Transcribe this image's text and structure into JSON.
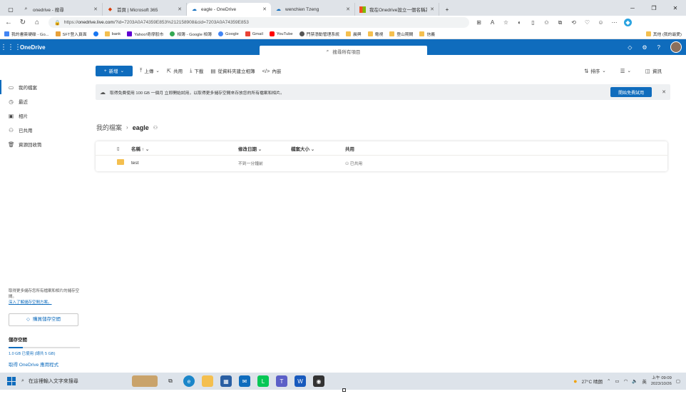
{
  "browser": {
    "tabs": [
      {
        "title": "onedrive - 搜尋",
        "icon": "search-icon",
        "active": false
      },
      {
        "title": "首頁 | Microsoft 365",
        "icon": "m365-icon",
        "active": false
      },
      {
        "title": "eagle - OneDrive",
        "icon": "onedrive-icon",
        "active": true
      },
      {
        "title": "wenchien Tzeng",
        "icon": "onedrive-icon",
        "active": false
      },
      {
        "title": "我在Onedrive設立一個名稱為ea",
        "icon": "microsoft-icon",
        "active": false
      }
    ],
    "new_tab": "+",
    "url_prefix": "https://",
    "url_host": "onedrive.live.com",
    "url_rest": "/?id=7203A0A74359E853%212158908&cid=7203A0A74359E853",
    "bookmarks": [
      {
        "label": "我的書簽硬碟 - Go...",
        "color": "#4285f4"
      },
      {
        "label": "SFT登入頁面",
        "color": "#e8a13a"
      },
      {
        "label": "",
        "color": "#1877f2"
      },
      {
        "label": "bank",
        "color": "#f4bf4f"
      },
      {
        "label": "Yahoo!奇摩股市",
        "color": "#6001d2"
      },
      {
        "label": "相簿 - Google 相簿",
        "color": "#34a853"
      },
      {
        "label": "Google",
        "color": "#4285f4"
      },
      {
        "label": "Gmail",
        "color": "#ea4335"
      },
      {
        "label": "YouTube",
        "color": "#ff0000"
      },
      {
        "label": "門禁憑動管理系統",
        "color": "#555555"
      },
      {
        "label": "晨興",
        "color": "#f4bf4f"
      },
      {
        "label": "電視",
        "color": "#f4bf4f"
      },
      {
        "label": "登山期間",
        "color": "#f4bf4f"
      },
      {
        "label": "信義",
        "color": "#f4bf4f"
      }
    ],
    "bookmarks_other": "其他 (我的最愛)"
  },
  "onedrive": {
    "brand": "OneDrive",
    "search_placeholder": "搜尋所有項目",
    "nav": [
      {
        "label": "我的檔案",
        "icon": "folder-icon",
        "selected": true
      },
      {
        "label": "最近",
        "icon": "clock-icon",
        "selected": false
      },
      {
        "label": "相片",
        "icon": "photo-icon",
        "selected": false
      },
      {
        "label": "已共用",
        "icon": "people-icon",
        "selected": false
      },
      {
        "label": "資源回收筒",
        "icon": "trash-icon",
        "selected": false
      }
    ],
    "upsell_text": "取得更多儲存您所有檔案和相片的儲存空間。",
    "upsell_link": "深入了解儲存空間方案。",
    "buy_storage": "購買儲存空間",
    "storage_title": "儲存空間",
    "storage_used_text": "1.0 GB 已使用 (總共 5 GB)",
    "storage_used_fraction": 0.2,
    "get_apps": "取得 OneDrive 應用程式",
    "commands": {
      "new": "新增",
      "upload": "上傳",
      "share": "共用",
      "download": "下載",
      "create_album": "從資料夾建立相簿",
      "embed": "內嵌",
      "sort": "排序",
      "view": "",
      "info": "資訊"
    },
    "banner_text": "取得免費使用 100 GB 一個月   立即開始試用，以取得更多儲存空間來存放您的所有檔案和相片。",
    "banner_button": "開始免費試用",
    "breadcrumb_parent": "我的檔案",
    "breadcrumb_current": "eagle",
    "columns": {
      "name": "名稱",
      "modified": "修改日期",
      "size": "檔案大小",
      "sharing": "共用"
    },
    "files": [
      {
        "name": "test",
        "modified": "不到一分鐘前",
        "size": "",
        "sharing": "已共用"
      }
    ]
  },
  "taskbar": {
    "search_placeholder": "在這裡輸入文字來搜尋",
    "weather": "27°C 晴朗",
    "lang": "英",
    "time": "上午 09:09",
    "date": "2023/10/26"
  }
}
